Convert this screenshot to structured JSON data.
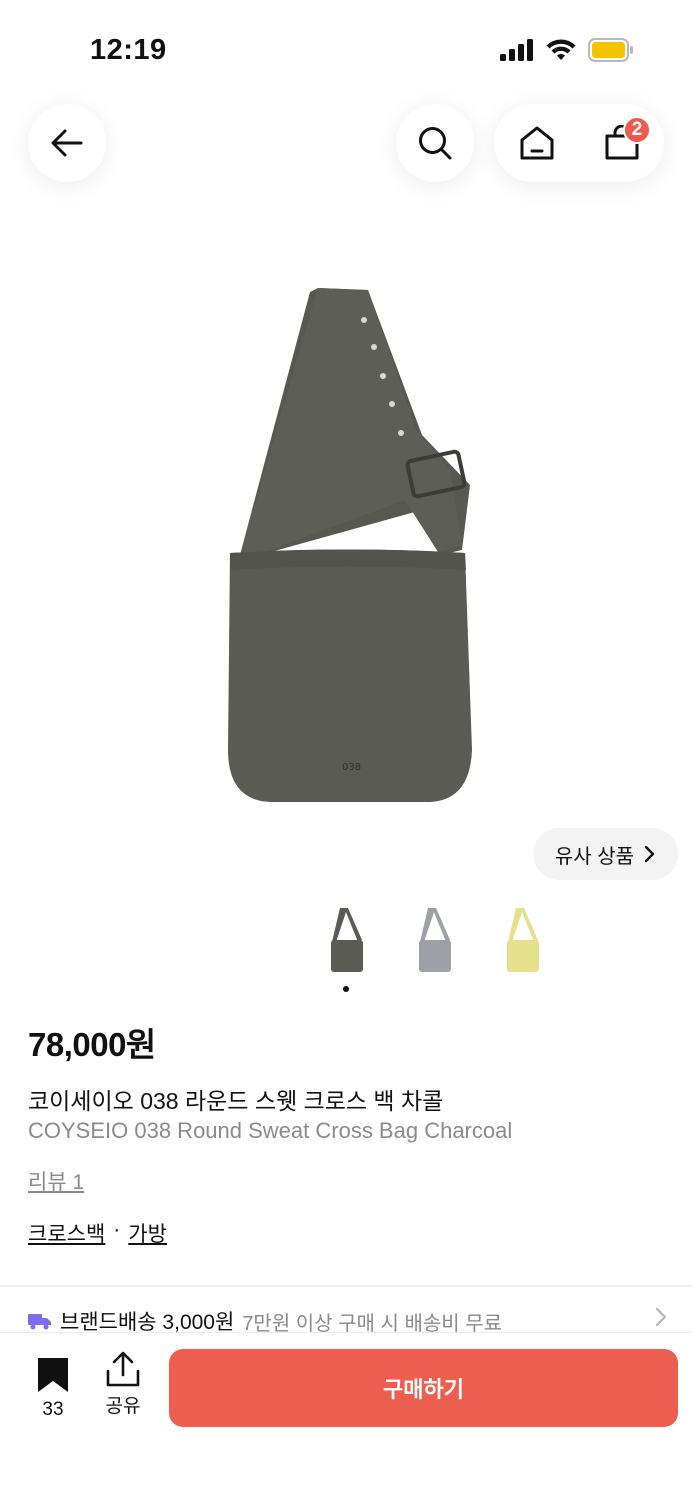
{
  "status_bar": {
    "time": "12:19",
    "battery_color": "#f5c400"
  },
  "top_nav": {
    "back_icon": "arrow-left-icon",
    "search_icon": "search-icon",
    "home_icon": "home-icon",
    "cart_icon": "shopping-bag-icon",
    "cart_count": "2"
  },
  "product": {
    "bag_color": "#5a5b55",
    "bag_logo": "038",
    "similar_label": "유사 상품",
    "thumbnails": [
      {
        "color": "#5a5b55",
        "name": "Charcoal"
      },
      {
        "color": "#9da1a5",
        "name": "Grey"
      },
      {
        "color": "#e6df8c",
        "name": "Yellow"
      }
    ],
    "price": "78,000원",
    "title_ko": "코이세이오 038 라운드 스웻 크로스 백 차콜",
    "title_en": "COYSEIO 038 Round Sweat Cross Bag Charcoal",
    "review": "리뷰 1",
    "category": [
      "크로스백",
      "가방"
    ],
    "category_sep": "·"
  },
  "delivery": {
    "brand_label": "브랜드배송 3,000원",
    "desc": "7만원 이상 구매 시 배송비 무료",
    "icon_color": "#7b6cf0"
  },
  "bottom_bar": {
    "bookmark_count": "33",
    "share_label": "공유",
    "buy_label": "구매하기",
    "accent": "#ee5e50"
  }
}
